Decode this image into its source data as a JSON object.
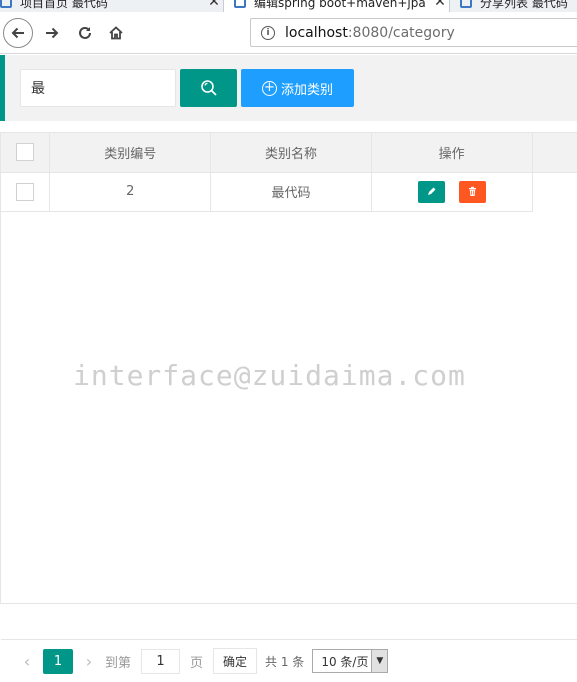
{
  "browser": {
    "tabs": [
      {
        "title": "项目首页 最代码",
        "close": "✕"
      },
      {
        "title": "编辑spring boot+maven+jpa",
        "close": "✕"
      },
      {
        "title": "分享列表 最代码",
        "close": "✕"
      }
    ],
    "url_host": "localhost",
    "url_rest": ":8080/category"
  },
  "search": {
    "value": "最",
    "search_icon": "search-icon",
    "add_label": "添加类别"
  },
  "table": {
    "columns": [
      "类别编号",
      "类别名称",
      "操作"
    ],
    "rows": [
      {
        "id": "2",
        "name": "最代码"
      }
    ]
  },
  "watermark": "interface@zuidaima.com",
  "pager": {
    "current_page": "1",
    "goto_label": "到第",
    "goto_value": "1",
    "page_unit": "页",
    "confirm_label": "确定",
    "total_text": "共 1 条",
    "page_size": "10 条/页"
  },
  "colors": {
    "primary": "#009688",
    "blue": "#1e9fff",
    "danger": "#ff5722"
  }
}
